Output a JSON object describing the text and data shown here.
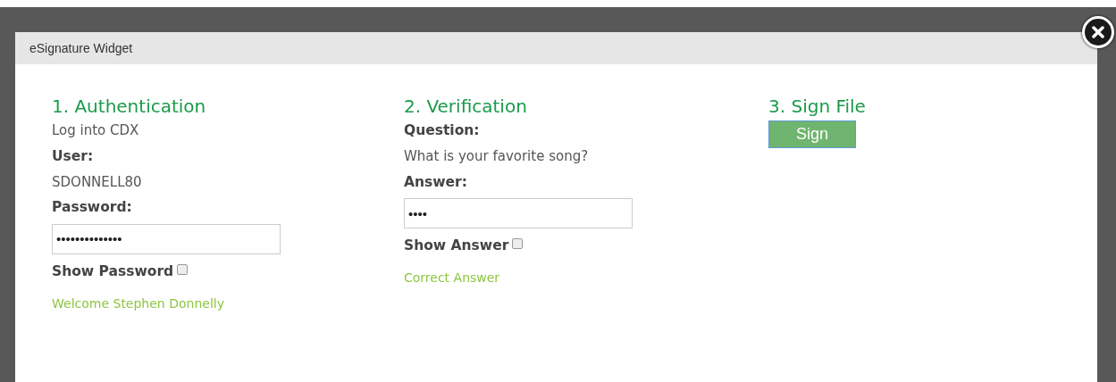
{
  "dialog": {
    "title": "eSignature Widget"
  },
  "sections": [
    {
      "heading": "1. Authentication",
      "items": [
        {
          "kind": "text",
          "text": "Log into CDX"
        },
        {
          "kind": "label",
          "text": "User:"
        },
        {
          "kind": "text",
          "text": "SDONNELL80"
        },
        {
          "kind": "label",
          "text": "Password:"
        },
        {
          "kind": "field",
          "value": "••••••••••••••"
        },
        {
          "kind": "checkbox",
          "text": "Show Password",
          "checked": false
        },
        {
          "kind": "message",
          "text": "Welcome Stephen Donnelly"
        }
      ]
    },
    {
      "heading": "2. Verification",
      "items": [
        {
          "kind": "label",
          "text": "Question:"
        },
        {
          "kind": "text",
          "text": "What is your favorite song?"
        },
        {
          "kind": "label",
          "text": "Answer:"
        },
        {
          "kind": "field",
          "value": "••••"
        },
        {
          "kind": "checkbox",
          "text": "Show Answer",
          "checked": false
        },
        {
          "kind": "message",
          "text": "Correct Answer"
        }
      ]
    },
    {
      "heading": "3. Sign File",
      "items": [
        {
          "kind": "button",
          "text": "Sign"
        }
      ]
    }
  ]
}
